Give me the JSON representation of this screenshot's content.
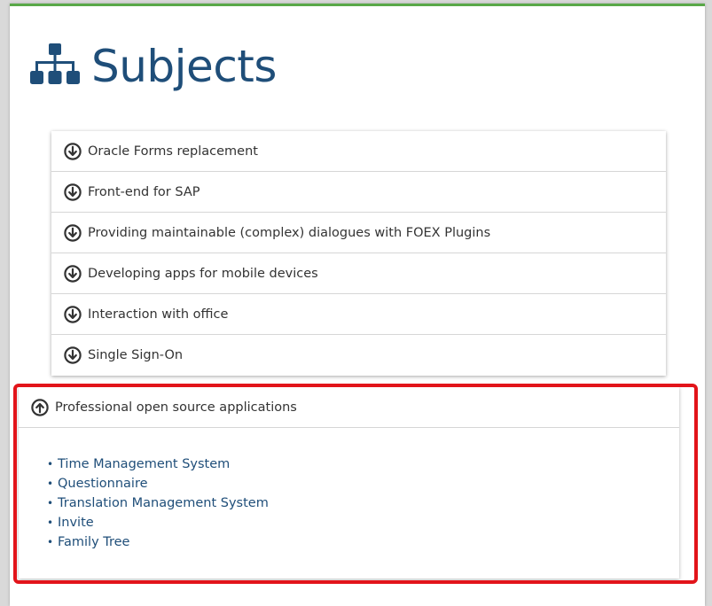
{
  "page": {
    "title": "Subjects",
    "title_icon": "sitemap-icon",
    "accent_color": "#59a848",
    "title_color": "#1f4e79"
  },
  "subjects": [
    {
      "label": "Oracle Forms replacement",
      "icon": "arrow-circle-down-icon"
    },
    {
      "label": "Front-end for SAP",
      "icon": "arrow-circle-down-icon"
    },
    {
      "label": "Providing maintainable (complex) dialogues with FOEX Plugins",
      "icon": "arrow-circle-down-icon"
    },
    {
      "label": "Developing apps for mobile devices",
      "icon": "arrow-circle-down-icon"
    },
    {
      "label": "Interaction with office",
      "icon": "arrow-circle-down-icon"
    },
    {
      "label": "Single Sign-On",
      "icon": "arrow-circle-down-icon"
    }
  ],
  "expanded": {
    "label": "Professional open source applications",
    "icon": "arrow-circle-up-icon",
    "links": [
      "Time Management System",
      "Questionnaire",
      "Translation Management System",
      "Invite",
      "Family Tree"
    ]
  },
  "highlight_color": "#e2141a"
}
